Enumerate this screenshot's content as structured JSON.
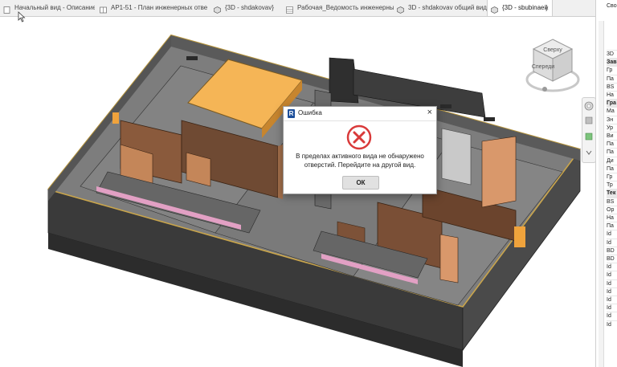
{
  "tabs": [
    {
      "label": "Начальный вид - Описание шабл...",
      "icon": "document-icon",
      "active": false
    },
    {
      "label": "АР1-51 - План инженерных отвер...",
      "icon": "floor-plan-icon",
      "active": false
    },
    {
      "label": "{3D - shdakovav}",
      "icon": "3d-view-icon",
      "active": false
    },
    {
      "label": "Рабочая_Ведомость инженерны...",
      "icon": "schedule-icon",
      "active": false
    },
    {
      "label": "3D - shdakovav общий вид",
      "icon": "3d-view-icon",
      "active": false
    },
    {
      "label": "{3D - sbubinaei}",
      "icon": "3d-view-icon",
      "active": true,
      "close": "×"
    }
  ],
  "viewcube": {
    "top_label": "Сверху",
    "front_label": "Спереди"
  },
  "properties_panel": {
    "header": "Сво",
    "rows": [
      "3D",
      "Зав",
      "Гр",
      "Па",
      "BS",
      "На",
      "Гра",
      "Ма",
      "Зн",
      "Ур",
      "Ви",
      "Па",
      "Па",
      "Ди",
      "Па",
      "Гр",
      "Тр",
      "Тек",
      "BS",
      "Ор",
      "На",
      "Па",
      "Id",
      "Id",
      "BD",
      "BD",
      "Id",
      "Id",
      "Id",
      "Id",
      "Id",
      "Id",
      "Id",
      "Id"
    ]
  },
  "dialog": {
    "title": "Ошибка",
    "close": "×",
    "message_line1": "В пределах активного вида не обнаружено",
    "message_line2": "отверстий. Перейдите на другой вид.",
    "ok_label": "ОК"
  },
  "colors": {
    "accent": "#1c4e9a",
    "error": "#d93a3a",
    "floor": "#7c7c7c",
    "wall": "#3c3c3c",
    "timber": "#8a5a3c",
    "orange": "#f5b556"
  }
}
